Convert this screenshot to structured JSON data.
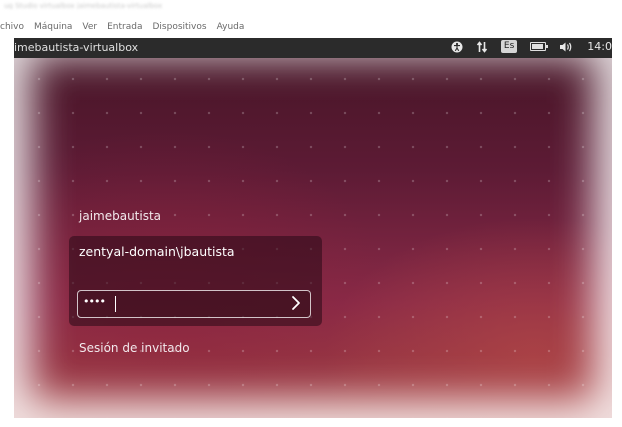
{
  "window": {
    "blurred_title": "ug Studio virtualbox jaimebautista-virtualbox"
  },
  "menubar": {
    "items": [
      "chivo",
      "Máquina",
      "Ver",
      "Entrada",
      "Dispositivos",
      "Ayuda"
    ]
  },
  "top_panel": {
    "hostname": "imebautista-virtualbox",
    "language": "Es",
    "clock": "14:0",
    "icons": [
      "accessibility-icon",
      "network-icon",
      "keyboard-language-icon",
      "battery-icon",
      "volume-icon"
    ]
  },
  "login": {
    "user_name": "jaimebautista",
    "domain_user": "zentyal-domain\\jbautista",
    "password_mask": "••••",
    "guest_session": "Sesión de invitado"
  },
  "colors": {
    "panel": "#2b2b2b",
    "wallpaper_dark": "#441425",
    "wallpaper_light": "#a3403f"
  }
}
